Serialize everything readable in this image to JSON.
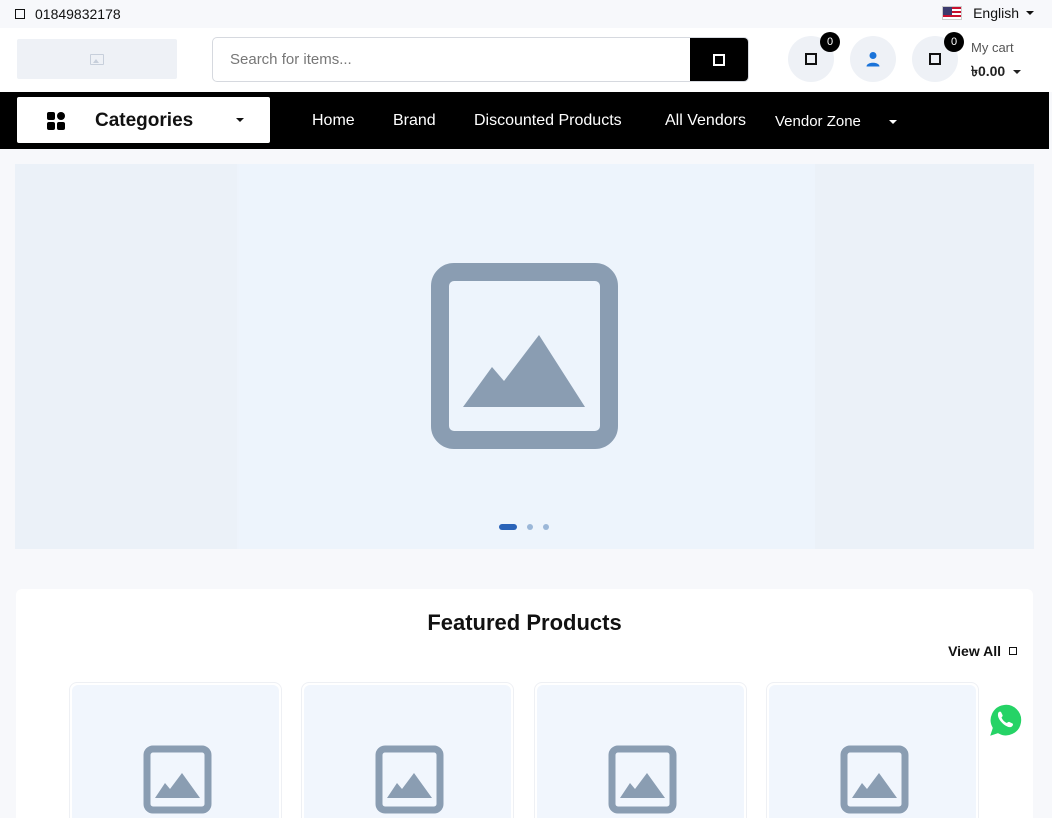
{
  "topbar": {
    "phone": "01849832178",
    "language": "English"
  },
  "header": {
    "search_placeholder": "Search for items...",
    "wishlist_count": "0",
    "cart_count": "0",
    "cart_label": "My cart",
    "cart_total": "৳0.00"
  },
  "nav": {
    "categories_label": "Categories",
    "links": [
      "Home",
      "Brand",
      "Discounted Products",
      "All Vendors",
      "Vendor Zone"
    ]
  },
  "hero": {
    "slides": 3,
    "active_slide": 1
  },
  "featured": {
    "title": "Featured Products",
    "view_all": "View All",
    "product_cards": 4
  },
  "colors": {
    "brand_black": "#000000",
    "user_icon": "#1a73d9",
    "placeholder_gray": "#8a9db2",
    "hero_bg": "#edf3fb",
    "whatsapp_green": "#25d366"
  }
}
